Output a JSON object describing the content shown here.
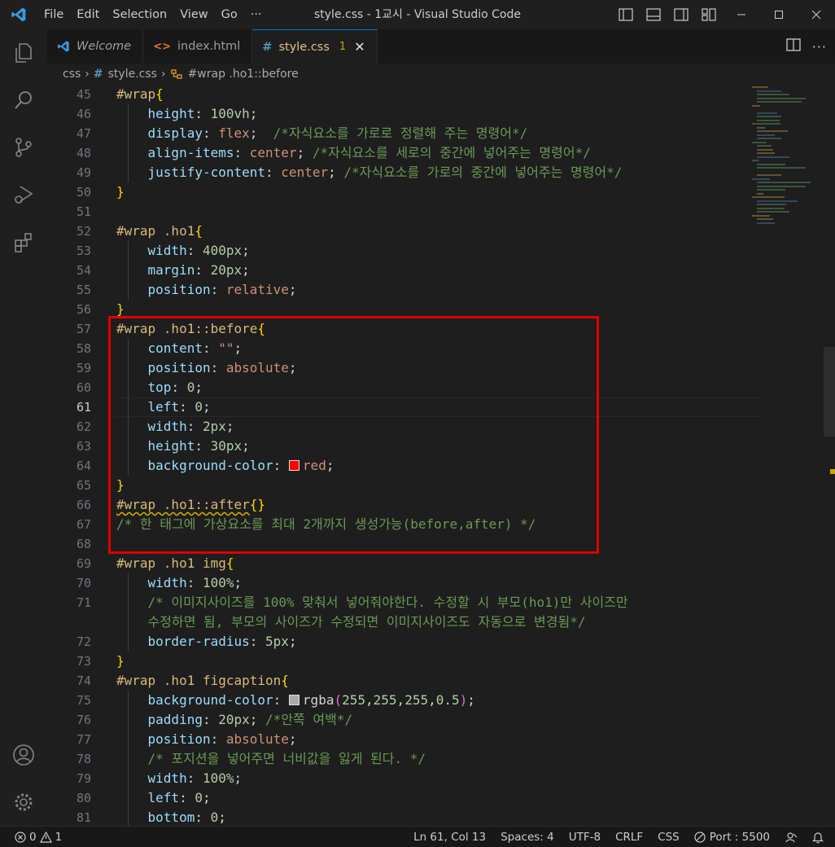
{
  "window": {
    "title": "style.css - 1교시 - Visual Studio Code",
    "menu": [
      "File",
      "Edit",
      "Selection",
      "View",
      "Go",
      "···"
    ]
  },
  "tabs": [
    {
      "label": "Welcome",
      "icon": "vscode-icon"
    },
    {
      "label": "index.html",
      "icon": "html-icon"
    },
    {
      "label": "style.css",
      "icon": "css-hash-icon",
      "badge": "1",
      "close": "✕"
    }
  ],
  "breadcrumb": {
    "folder": "css",
    "file": "style.css",
    "symbol": "#wrap .ho1::before"
  },
  "editor": {
    "line_numbers": [
      "45",
      "46",
      "47",
      "48",
      "49",
      "50",
      "51",
      "52",
      "53",
      "54",
      "55",
      "56",
      "57",
      "58",
      "59",
      "60",
      "61",
      "62",
      "63",
      "64",
      "65",
      "66",
      "67",
      "68",
      "69",
      "70",
      "71",
      "",
      "72",
      "73",
      "74",
      "75",
      "76",
      "77",
      "78",
      "79",
      "80",
      "81"
    ],
    "current_line": "61"
  },
  "status": {
    "errors": "0",
    "warnings": "1",
    "position": "Ln 61, Col 13",
    "spaces": "Spaces: 4",
    "encoding": "UTF-8",
    "eol": "CRLF",
    "language": "CSS",
    "port": "Port : 5500"
  },
  "colors": {
    "accent": "#0078d4",
    "highlight_box": "#e00000",
    "warning": "#cca700"
  }
}
